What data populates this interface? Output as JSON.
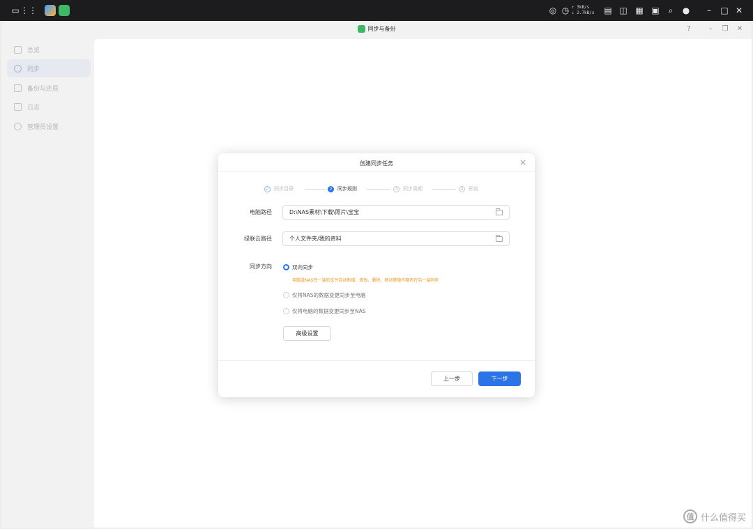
{
  "topbar": {
    "speed_up": "↑ 3kB/s",
    "speed_down": "↓ 2.7kB/s",
    "icons": [
      "window-icon",
      "apps-grid-icon",
      "photos-app-icon",
      "sync-app-icon",
      "network-icon",
      "clock-icon",
      "list-icon",
      "panel-icon",
      "note-icon",
      "notification-icon",
      "search-icon",
      "user-icon",
      "minimize-icon",
      "restore-icon",
      "close-icon"
    ]
  },
  "window": {
    "title": "同步与备份",
    "help": "?",
    "minimize": "–",
    "restore": "❐",
    "close": "✕"
  },
  "sidebar": {
    "items": [
      {
        "label": "总览",
        "icon": "grid-icon"
      },
      {
        "label": "同步",
        "icon": "sync-icon"
      },
      {
        "label": "备份与还原",
        "icon": "backup-icon"
      },
      {
        "label": "日志",
        "icon": "log-icon"
      },
      {
        "label": "管理员设置",
        "icon": "settings-icon"
      }
    ]
  },
  "modal": {
    "title": "创建同步任务",
    "close": "×",
    "steps": [
      {
        "label": "同步目录",
        "state": "done",
        "marker": "✓"
      },
      {
        "label": "同步规则",
        "state": "current",
        "marker": "2"
      },
      {
        "label": "同步周期",
        "state": "pending",
        "marker": "3"
      },
      {
        "label": "预览",
        "state": "pending",
        "marker": "4"
      }
    ],
    "pc_path_label": "电脑路径",
    "pc_path_value": "D:\\NAS素材\\下载\\照片\\宝宝",
    "cloud_path_label": "绿联云路径",
    "cloud_path_value": "个人文件夹/我的资料",
    "direction_label": "同步方向",
    "options": [
      {
        "label": "双向同步",
        "checked": true
      },
      {
        "label": "仅将NAS的数据变更同步至电脑",
        "checked": false
      },
      {
        "label": "仅将电脑的数据变更同步至NAS",
        "checked": false
      }
    ],
    "warning": "电脑或NAS任一端的文件自动新增、修改、删除、移动等操作都将在另一端同步",
    "advanced_button": "高级设置",
    "prev_button": "上一步",
    "next_button": "下一步"
  },
  "watermark": {
    "logo": "值",
    "text": "什么值得买"
  },
  "colors": {
    "accent": "#2b74e8",
    "warning": "#f0961c",
    "topbar": "#1c1c1e"
  }
}
